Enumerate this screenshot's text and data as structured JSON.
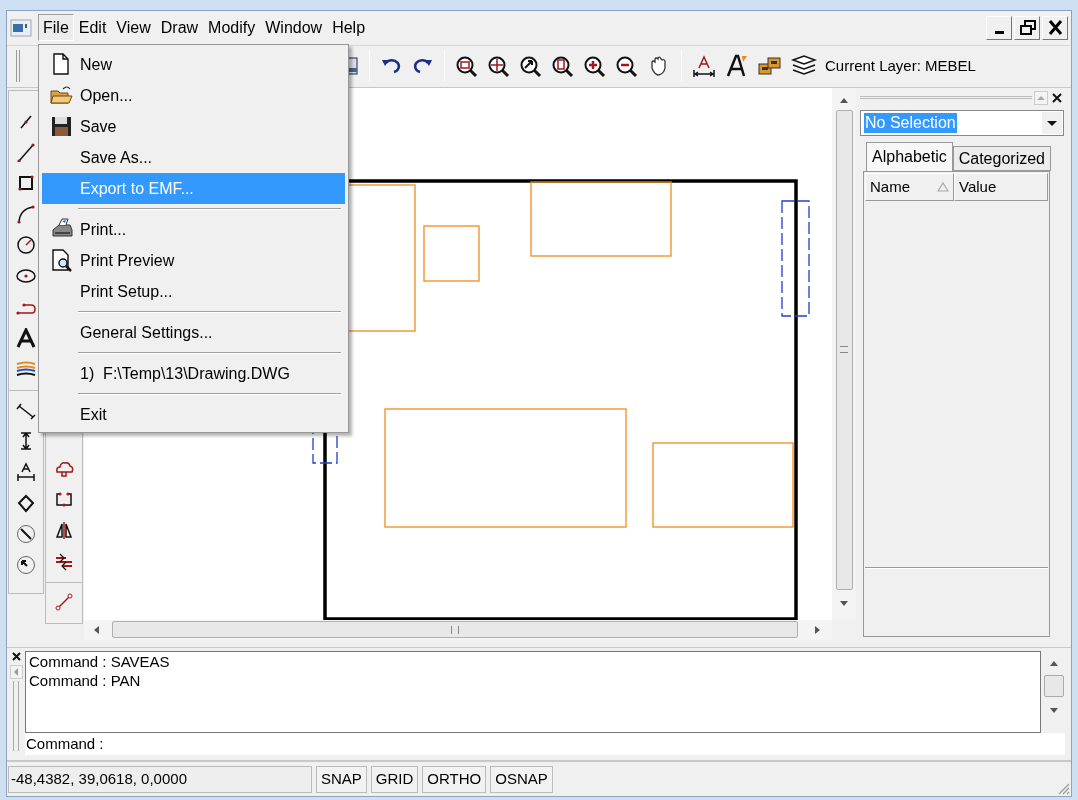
{
  "menu_bar": [
    {
      "label": "File",
      "selected": true
    },
    {
      "label": "Edit",
      "selected": false
    },
    {
      "label": "View",
      "selected": false
    },
    {
      "label": "Draw",
      "selected": false
    },
    {
      "label": "Modify",
      "selected": false
    },
    {
      "label": "Window",
      "selected": false
    },
    {
      "label": "Help",
      "selected": false
    }
  ],
  "toolbar": {
    "current_layer": "Current Layer: MEBEL"
  },
  "file_menu": [
    {
      "kind": "item",
      "label": "New",
      "selected": false
    },
    {
      "kind": "item",
      "label": "Open...",
      "selected": false
    },
    {
      "kind": "item",
      "label": "Save",
      "selected": false
    },
    {
      "kind": "item",
      "label": "Save As...",
      "selected": false
    },
    {
      "kind": "item",
      "label": "Export to EMF...",
      "selected": true
    },
    {
      "kind": "separator"
    },
    {
      "kind": "item",
      "label": "Print...",
      "selected": false
    },
    {
      "kind": "item",
      "label": "Print Preview",
      "selected": false
    },
    {
      "kind": "item",
      "label": "Print Setup...",
      "selected": false
    },
    {
      "kind": "separator"
    },
    {
      "kind": "item",
      "label": "General Settings...",
      "selected": false
    },
    {
      "kind": "separator"
    },
    {
      "kind": "item",
      "label": "1)  F:\\Temp\\13\\Drawing.DWG",
      "selected": false
    },
    {
      "kind": "separator"
    },
    {
      "kind": "item",
      "label": "Exit",
      "selected": false
    }
  ],
  "properties": {
    "selector": "No Selection",
    "tabs": [
      {
        "label": "Alphabetic",
        "selected": true
      },
      {
        "label": "Categorized",
        "selected": false
      }
    ],
    "columns": [
      "Name",
      "Value"
    ]
  },
  "command": {
    "history": [
      "Command : SAVEAS",
      "Command : PAN"
    ],
    "prompt": "Command :"
  },
  "status_bar": {
    "coordinates": "-48,4382, 39,0618, 0,0000",
    "toggles": [
      "SNAP",
      "GRID",
      "ORTHO",
      "OSNAP"
    ]
  }
}
